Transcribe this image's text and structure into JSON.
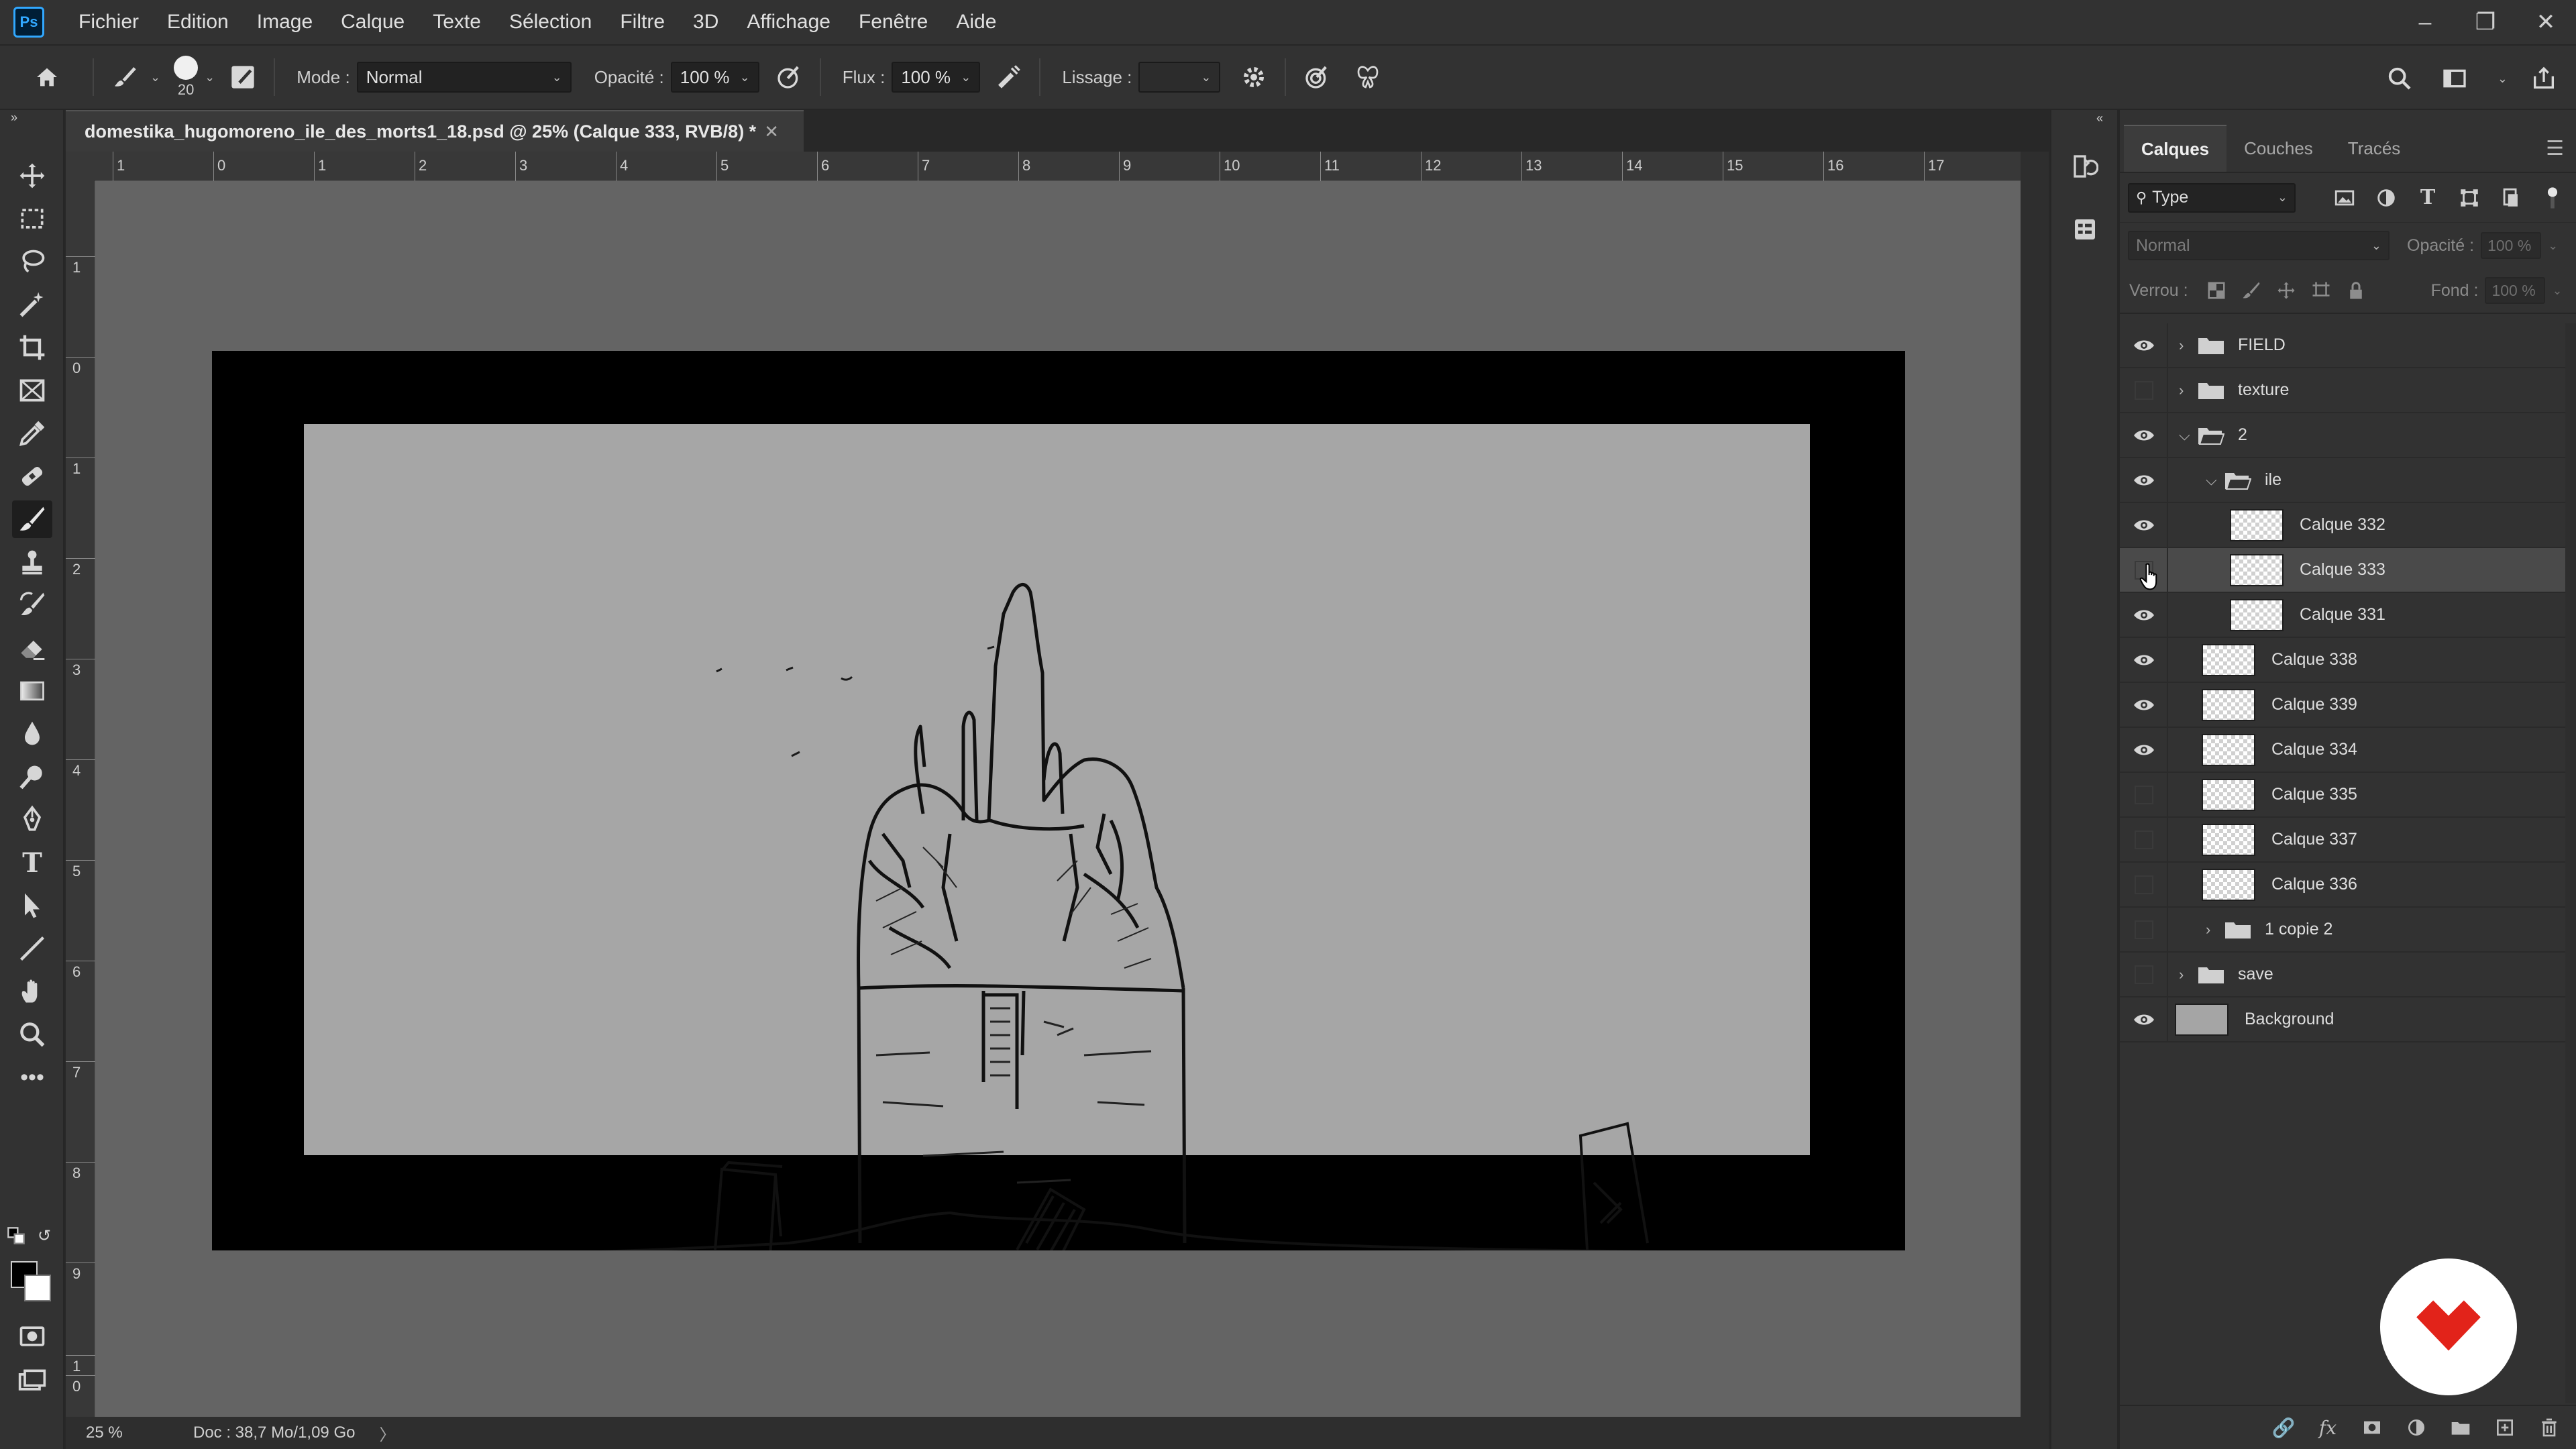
{
  "app": {
    "logo_text": "Ps"
  },
  "menu": [
    "Fichier",
    "Edition",
    "Image",
    "Calque",
    "Texte",
    "Sélection",
    "Filtre",
    "3D",
    "Affichage",
    "Fenêtre",
    "Aide"
  ],
  "options": {
    "brush_size": "20",
    "mode_label": "Mode :",
    "mode_value": "Normal",
    "opacity_label": "Opacité :",
    "opacity_value": "100 %",
    "flow_label": "Flux :",
    "flow_value": "100 %",
    "smoothing_label": "Lissage :",
    "smoothing_value": ""
  },
  "document": {
    "tab_title": "domestika_hugomoreno_ile_des_morts1_18.psd @ 25% (Calque 333, RVB/8)",
    "tab_modified": "*",
    "ruler_top": [
      "1",
      "0",
      "1",
      "2",
      "3",
      "4",
      "5",
      "6",
      "7",
      "8",
      "9",
      "10",
      "11",
      "12",
      "13",
      "14",
      "15",
      "16",
      "17"
    ],
    "ruler_left": [
      "1",
      "0",
      "1",
      "2",
      "3",
      "4",
      "5",
      "6",
      "7",
      "8",
      "9",
      "1",
      "0"
    ]
  },
  "status": {
    "zoom": "25 %",
    "doc_info": "Doc : 38,7 Mo/1,09 Go",
    "arrow": "〉"
  },
  "layers_panel": {
    "tabs": [
      "Calques",
      "Couches",
      "Tracés"
    ],
    "active_tab": "Calques",
    "filter_type": "Type",
    "blend_mode": "Normal",
    "opacity_label": "Opacité :",
    "opacity_value": "100 %",
    "lock_label": "Verrou :",
    "fill_label": "Fond :",
    "fill_value": "100 %",
    "layers": [
      {
        "name": "FIELD",
        "kind": "group",
        "visible": true,
        "indent": 0,
        "expanded": false
      },
      {
        "name": "texture",
        "kind": "group",
        "visible": false,
        "indent": 0,
        "expanded": false
      },
      {
        "name": "2",
        "kind": "group",
        "visible": true,
        "indent": 0,
        "expanded": true
      },
      {
        "name": "ile",
        "kind": "group",
        "visible": true,
        "indent": 1,
        "expanded": true
      },
      {
        "name": "Calque 332",
        "kind": "layer",
        "visible": true,
        "indent": 2
      },
      {
        "name": "Calque 333",
        "kind": "layer",
        "visible": false,
        "indent": 2,
        "selected": true
      },
      {
        "name": "Calque 331",
        "kind": "layer",
        "visible": true,
        "indent": 2
      },
      {
        "name": "Calque 338",
        "kind": "layer",
        "visible": true,
        "indent": 1
      },
      {
        "name": "Calque 339",
        "kind": "layer",
        "visible": true,
        "indent": 1
      },
      {
        "name": "Calque 334",
        "kind": "layer",
        "visible": true,
        "indent": 1
      },
      {
        "name": "Calque 335",
        "kind": "layer",
        "visible": false,
        "indent": 1
      },
      {
        "name": "Calque 337",
        "kind": "layer",
        "visible": false,
        "indent": 1
      },
      {
        "name": "Calque 336",
        "kind": "layer",
        "visible": false,
        "indent": 1
      },
      {
        "name": "1 copie 2",
        "kind": "group",
        "visible": false,
        "indent": 1,
        "expanded": false
      },
      {
        "name": "save",
        "kind": "group",
        "visible": false,
        "indent": 0,
        "expanded": false
      },
      {
        "name": "Background",
        "kind": "background",
        "visible": true,
        "indent": 0
      }
    ]
  },
  "colors": {
    "accent": "#31a8ff",
    "watermark": "#e2231a"
  }
}
